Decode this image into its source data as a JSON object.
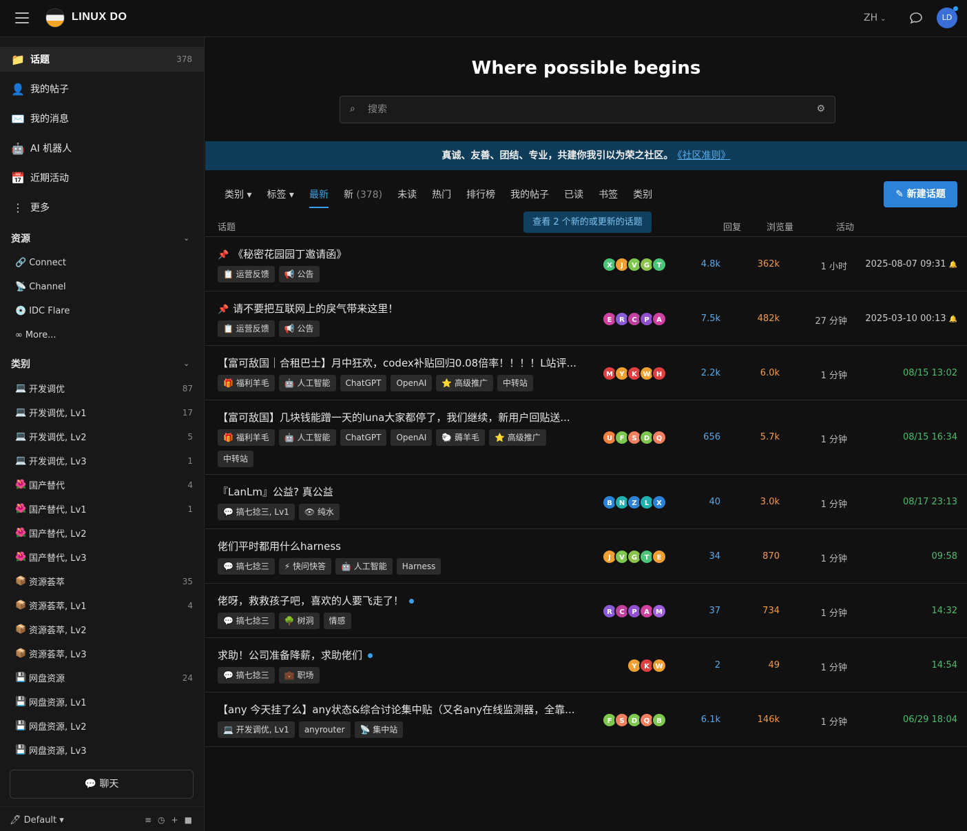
{
  "header": {
    "brand": "LINUX DO",
    "lang": "ZH",
    "avatar_text": "LD"
  },
  "sidebar": {
    "main_items": [
      {
        "icon": "📁",
        "label": "话题",
        "count": "378"
      },
      {
        "icon": "👤",
        "label": "我的帖子"
      },
      {
        "icon": "✉️",
        "label": "我的消息"
      },
      {
        "icon": "🤖",
        "label": "AI 机器人"
      },
      {
        "icon": "📅",
        "label": "近期活动"
      },
      {
        "icon": "⋮",
        "label": "更多"
      }
    ],
    "resources_title": "资源",
    "resources": [
      {
        "icon": "🔗",
        "label": "Connect"
      },
      {
        "icon": "📡",
        "label": "Channel"
      },
      {
        "icon": "💿",
        "label": "IDC Flare"
      },
      {
        "icon": "∞",
        "label": "More..."
      }
    ],
    "categories_title": "类别",
    "categories": [
      {
        "icon": "💻",
        "label": "开发调优",
        "count": "87"
      },
      {
        "icon": "💻",
        "label": "开发调优, Lv1",
        "count": "17"
      },
      {
        "icon": "💻",
        "label": "开发调优, Lv2",
        "count": "5"
      },
      {
        "icon": "💻",
        "label": "开发调优, Lv3",
        "count": "1"
      },
      {
        "icon": "🌺",
        "label": "国产替代",
        "count": "4"
      },
      {
        "icon": "🌺",
        "label": "国产替代, Lv1",
        "count": "1"
      },
      {
        "icon": "🌺",
        "label": "国产替代, Lv2",
        "count": ""
      },
      {
        "icon": "🌺",
        "label": "国产替代, Lv3",
        "count": ""
      },
      {
        "icon": "📦",
        "label": "资源荟萃",
        "count": "35"
      },
      {
        "icon": "📦",
        "label": "资源荟萃, Lv1",
        "count": "4"
      },
      {
        "icon": "📦",
        "label": "资源荟萃, Lv2",
        "count": ""
      },
      {
        "icon": "📦",
        "label": "资源荟萃, Lv3",
        "count": ""
      },
      {
        "icon": "💾",
        "label": "网盘资源",
        "count": "24"
      },
      {
        "icon": "💾",
        "label": "网盘资源, Lv1",
        "count": ""
      },
      {
        "icon": "💾",
        "label": "网盘资源, Lv2",
        "count": ""
      },
      {
        "icon": "💾",
        "label": "网盘资源, Lv3",
        "count": ""
      }
    ],
    "chat_label": "💬 聊天",
    "footer_label": "Default ▾",
    "footer_tools": "≡◷+■"
  },
  "main": {
    "hero": "Where possible begins",
    "search_placeholder": "搜索",
    "banner_text": "真诚、友善、团结、专业，共建你我引以为荣之社区。",
    "banner_link": "《社区准则》",
    "tabs": [
      {
        "label": "类别 ▾",
        "active": false
      },
      {
        "label": "标签 ▾",
        "active": false
      },
      {
        "label": "最新",
        "active": true
      },
      {
        "label": "新",
        "count": "(378)",
        "active": false
      },
      {
        "label": "未读",
        "active": false
      },
      {
        "label": "热门",
        "active": false
      },
      {
        "label": "排行榜",
        "active": false
      },
      {
        "label": "我的帖子",
        "active": false
      },
      {
        "label": "已读",
        "active": false
      },
      {
        "label": "书签",
        "active": false
      },
      {
        "label": "类别",
        "active": false
      }
    ],
    "new_topic": "新建话题",
    "new_updates": "查看 2 个新的或更新的话题",
    "columns": {
      "topic": "话题",
      "replies": "回复",
      "views": "浏览量",
      "activity": "活动"
    },
    "topics": [
      {
        "title": "《秘密花园园丁邀请函》",
        "pinned": true,
        "dot": false,
        "tags": [
          "📋 运营反馈",
          "📢 公告"
        ],
        "avatars": [
          [
            "X",
            "#4cc47a"
          ],
          [
            "J",
            "#f0a030"
          ],
          [
            "V",
            "#7ec850"
          ],
          [
            "G",
            "#8ac24a"
          ],
          [
            "T",
            "#4cc47a"
          ]
        ],
        "replies": "4.8k",
        "views": "362k",
        "activity": "1 小时",
        "date": "2025-08-07 09:31",
        "bell": true,
        "recent": false
      },
      {
        "title": "请不要把互联网上的戾气带来这里！",
        "pinned": true,
        "dot": false,
        "tags": [
          "📋 运营反馈",
          "📢 公告"
        ],
        "avatars": [
          [
            "E",
            "#d040a0"
          ],
          [
            "R",
            "#8a5cd8"
          ],
          [
            "C",
            "#c040a0"
          ],
          [
            "P",
            "#9050d0"
          ],
          [
            "A",
            "#d040a0"
          ]
        ],
        "replies": "7.5k",
        "views": "482k",
        "activity": "27 分钟",
        "date": "2025-03-10 00:13",
        "bell": true,
        "recent": false
      },
      {
        "title": "【富可敌国｜合租巴士】月中狂欢，codex补贴回归0.08倍率！！！！L站评...",
        "pinned": false,
        "dot": false,
        "tags": [
          "🎁 福利羊毛",
          "🤖 人工智能",
          "ChatGPT",
          "OpenAI",
          "⭐ 高级推广",
          "中转站"
        ],
        "avatars": [
          [
            "M",
            "#e04040"
          ],
          [
            "Y",
            "#f0a030"
          ],
          [
            "K",
            "#e04040"
          ],
          [
            "W",
            "#f0a030"
          ],
          [
            "H",
            "#e04040"
          ]
        ],
        "replies": "2.2k",
        "views": "6.0k",
        "activity": "1 分钟",
        "date": "08/15 13:02",
        "bell": false,
        "recent": true
      },
      {
        "title": "【富可敌国】几块钱能蹭一天的luna大家都停了，我们继续，新用户回贴送...",
        "pinned": false,
        "dot": false,
        "tags": [
          "🎁 福利羊毛",
          "🤖 人工智能",
          "ChatGPT",
          "OpenAI",
          "🐑 薅羊毛",
          "⭐ 高级推广",
          "中转站"
        ],
        "avatars": [
          [
            "U",
            "#f08040"
          ],
          [
            "F",
            "#7ec850"
          ],
          [
            "S",
            "#f08060"
          ],
          [
            "D",
            "#7ec850"
          ],
          [
            "Q",
            "#f08060"
          ]
        ],
        "replies": "656",
        "views": "5.7k",
        "activity": "1 分钟",
        "date": "08/15 16:34",
        "bell": false,
        "recent": true
      },
      {
        "title": "『LanLm』公益? 真公益",
        "pinned": false,
        "dot": false,
        "tags": [
          "💬 搞七捻三, Lv1",
          "👁 纯水"
        ],
        "avatars": [
          [
            "B",
            "#2b82d6"
          ],
          [
            "N",
            "#20b0b0"
          ],
          [
            "Z",
            "#2b82d6"
          ],
          [
            "L",
            "#20b0b0"
          ],
          [
            "X",
            "#2b82d6"
          ]
        ],
        "replies": "40",
        "views": "3.0k",
        "activity": "1 分钟",
        "date": "08/17 23:13",
        "bell": false,
        "recent": true
      },
      {
        "title": "佬们平时都用什么harness",
        "pinned": false,
        "dot": false,
        "tags": [
          "💬 搞七捻三",
          "⚡ 快问快答",
          "🤖 人工智能",
          "Harness"
        ],
        "avatars": [
          [
            "J",
            "#f0a030"
          ],
          [
            "V",
            "#7ec850"
          ],
          [
            "G",
            "#8ac24a"
          ],
          [
            "T",
            "#4cc47a"
          ],
          [
            "E",
            "#f0a030"
          ]
        ],
        "replies": "34",
        "views": "870",
        "activity": "1 分钟",
        "date": "09:58",
        "bell": false,
        "recent": true
      },
      {
        "title": "佬呀，救救孩子吧，喜欢的人要飞走了！",
        "pinned": false,
        "dot": true,
        "tags": [
          "💬 搞七捻三",
          "🌳 树洞",
          "情感"
        ],
        "avatars": [
          [
            "R",
            "#8a5cd8"
          ],
          [
            "C",
            "#c040a0"
          ],
          [
            "P",
            "#9050d0"
          ],
          [
            "A",
            "#d040a0"
          ],
          [
            "M",
            "#a060e0"
          ]
        ],
        "replies": "37",
        "views": "734",
        "activity": "1 分钟",
        "date": "14:32",
        "bell": false,
        "recent": true
      },
      {
        "title": "求助！公司准备降薪，求助佬们",
        "pinned": false,
        "dot": true,
        "tags": [
          "💬 搞七捻三",
          "💼 职场"
        ],
        "avatars": [
          [
            "Y",
            "#f0a030"
          ],
          [
            "K",
            "#e04040"
          ],
          [
            "W",
            "#f0a030"
          ]
        ],
        "replies": "2",
        "views": "49",
        "activity": "1 分钟",
        "date": "14:54",
        "bell": false,
        "recent": true
      },
      {
        "title": "【any 今天挂了么】any状态&综合讨论集中贴（又名any在线监测器，全靠...",
        "pinned": false,
        "dot": false,
        "tags": [
          "💻 开发调优, Lv1",
          "anyrouter",
          "📡 集中站"
        ],
        "avatars": [
          [
            "F",
            "#7ec850"
          ],
          [
            "S",
            "#f08060"
          ],
          [
            "D",
            "#7ec850"
          ],
          [
            "Q",
            "#f08060"
          ],
          [
            "B",
            "#7ec850"
          ]
        ],
        "replies": "6.1k",
        "views": "146k",
        "activity": "1 分钟",
        "date": "06/29 18:04",
        "bell": false,
        "recent": true
      }
    ]
  },
  "colors": {
    "accent": "#2b82d6",
    "banner": "#0f3c58",
    "replies": "#5aa8e8",
    "views": "#f09a4a",
    "recent": "#4cbb6c"
  }
}
